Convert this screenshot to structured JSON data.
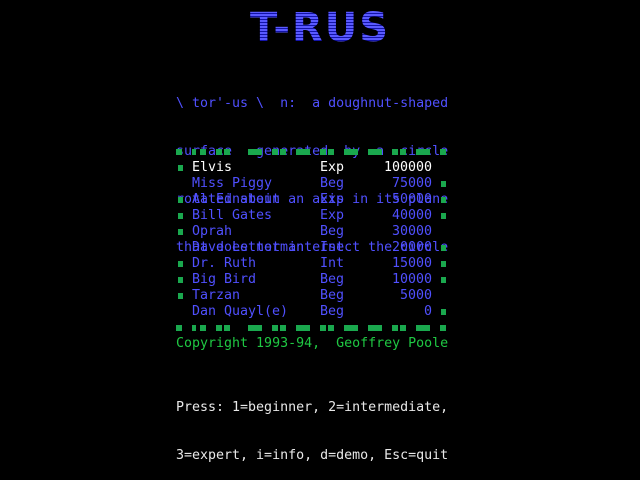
{
  "title": "T-RUS",
  "definition": [
    "\\ tor'-us \\  n:  a doughnut-shaped",
    "surface   generated  by  a  circle",
    "rotated about an axis in its plane",
    "that does not intersect the circle"
  ],
  "scores": [
    {
      "name": "Elvis",
      "level": "Exp",
      "points": "100000",
      "highlight": true,
      "left_mark": true,
      "right_mark": false
    },
    {
      "name": "Miss Piggy",
      "level": "Beg",
      "points": "75000",
      "highlight": false,
      "left_mark": false,
      "right_mark": true
    },
    {
      "name": "Al Einstein",
      "level": "Exp",
      "points": "50000",
      "highlight": false,
      "left_mark": true,
      "right_mark": true
    },
    {
      "name": "Bill Gates",
      "level": "Exp",
      "points": "40000",
      "highlight": false,
      "left_mark": true,
      "right_mark": true
    },
    {
      "name": "Oprah",
      "level": "Beg",
      "points": "30000",
      "highlight": false,
      "left_mark": true,
      "right_mark": false
    },
    {
      "name": "Dave Letterman",
      "level": "Int",
      "points": "20000",
      "highlight": false,
      "left_mark": false,
      "right_mark": true
    },
    {
      "name": "Dr. Ruth",
      "level": "Int",
      "points": "15000",
      "highlight": false,
      "left_mark": true,
      "right_mark": true
    },
    {
      "name": "Big Bird",
      "level": "Beg",
      "points": "10000",
      "highlight": false,
      "left_mark": true,
      "right_mark": true
    },
    {
      "name": "Tarzan",
      "level": "Beg",
      "points": "5000",
      "highlight": false,
      "left_mark": true,
      "right_mark": false
    },
    {
      "name": "Dan Quayl(e)",
      "level": "Beg",
      "points": "0",
      "highlight": false,
      "left_mark": false,
      "right_mark": true
    }
  ],
  "copyright": "Copyright 1993-94,  Geoffrey Poole",
  "help": [
    "Press: 1=beginner, 2=intermediate,",
    "3=expert, i=info, d=demo, Esc=quit"
  ],
  "colors": {
    "background": "#000000",
    "text_blue": "#5050ff",
    "highlight": "#ffffff",
    "green": "#1aa84e",
    "copyright": "#1fc843",
    "help_text": "#e8e8e8"
  }
}
